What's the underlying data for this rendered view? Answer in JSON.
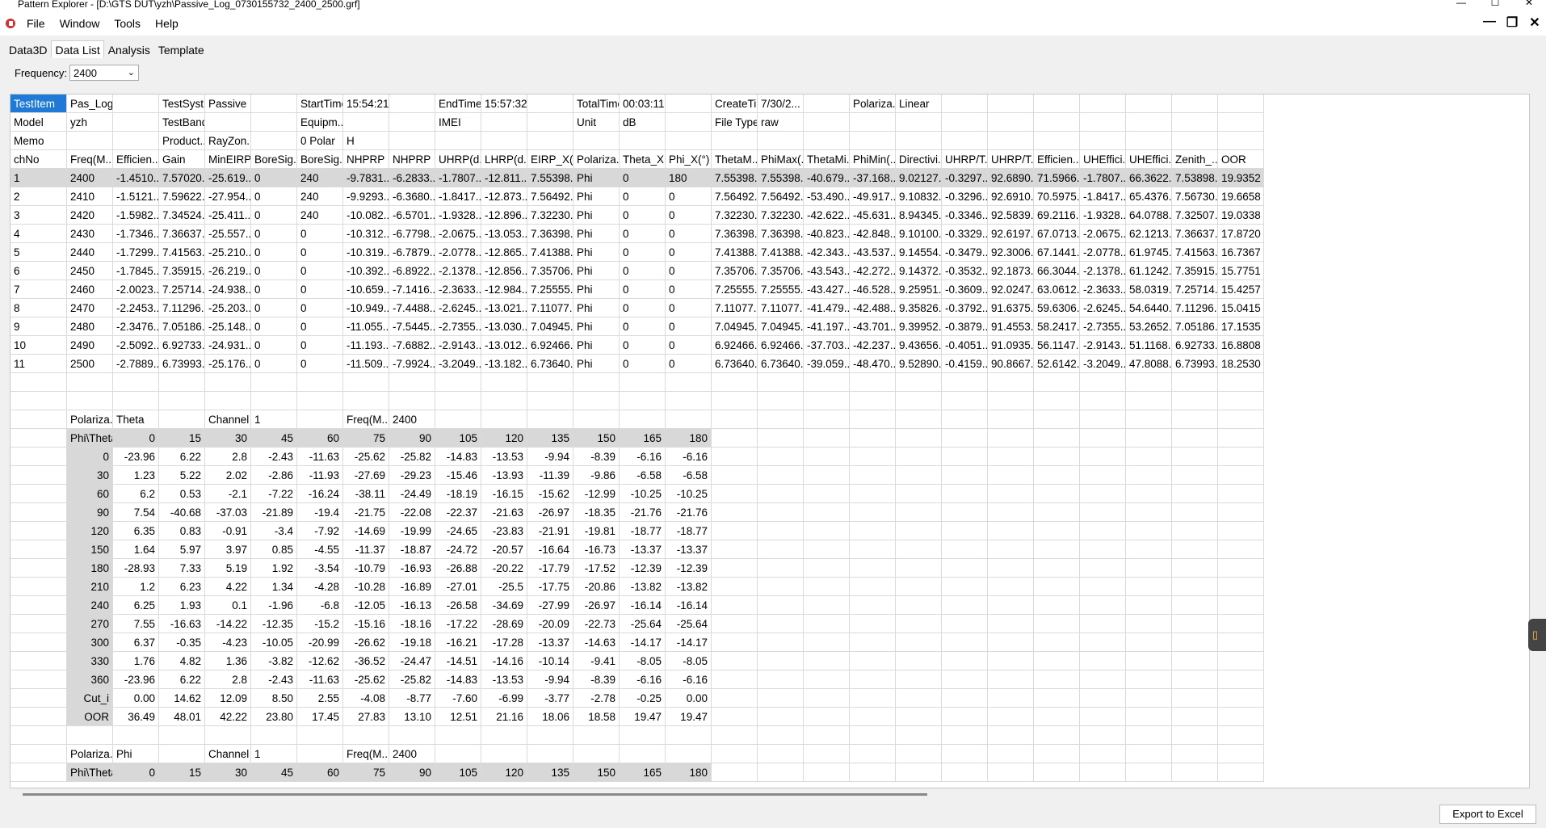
{
  "window": {
    "title": "Pattern Explorer - [D:\\GTS DUT\\yzh\\Passive_Log_0730155732_2400_2500.grf]"
  },
  "menu": [
    "File",
    "Window",
    "Tools",
    "Help"
  ],
  "tabs": [
    "Data3D",
    "Data List",
    "Analysis",
    "Template"
  ],
  "active_tab": "Data List",
  "frequency": {
    "label": "Frequency:",
    "value": "2400"
  },
  "export_label": "Export to Excel",
  "accent": "#1e7ad6",
  "rows": [
    [
      "TestItem",
      "Pas_Log",
      "",
      "TestSyst...",
      "Passive",
      "",
      "StartTime",
      "15:54:21",
      "",
      "EndTime",
      "15:57:32",
      "",
      "TotalTime",
      "00:03:11",
      "",
      "CreateTi...",
      "7/30/2...",
      "",
      "Polariza...",
      "Linear",
      "",
      "",
      "",
      "",
      "",
      "",
      ""
    ],
    [
      "Model",
      "yzh",
      "",
      "TestBand",
      "",
      "",
      "Equipm...",
      "",
      "",
      "IMEI",
      "",
      "",
      "Unit",
      "dB",
      "",
      "File Type",
      "raw",
      "",
      "",
      "",
      "",
      "",
      "",
      "",
      "",
      "",
      ""
    ],
    [
      "Memo",
      "",
      "",
      "Product...",
      "RayZon...",
      "",
      "0 Polar",
      "H",
      "",
      "",
      "",
      "",
      "",
      "",
      "",
      "",
      "",
      "",
      "",
      "",
      "",
      "",
      "",
      "",
      "",
      "",
      ""
    ],
    [
      "chNo",
      "Freq(M...",
      "Efficien...",
      "Gain",
      "MinEIRP...",
      "BoreSig...",
      "BoreSig...",
      "NHPRP ...",
      "NHPRP ...",
      "UHRP(d...",
      "LHRP(d...",
      "EIRP_X(...",
      "Polariza...",
      "Theta_X...",
      "Phi_X(°)",
      "ThetaM...",
      "PhiMax(...",
      "ThetaMi...",
      "PhiMin(...",
      "Directivi...",
      "UHRP/T...",
      "UHRP/T...",
      "Efficien...",
      "UHEffici...",
      "UHEffici...",
      "Zenith_...",
      "OOR"
    ],
    [
      "1",
      "2400",
      "-1.4510...",
      "7.57020...",
      "-25.619...",
      "0",
      "240",
      "-9.7831...",
      "-6.2833...",
      "-1.7807...",
      "-12.811...",
      "7.55398...",
      "Phi",
      "0",
      "180",
      "7.55398...",
      "7.55398...",
      "-40.679...",
      "-37.168...",
      "9.02127...",
      "-0.3297...",
      "92.6890...",
      "71.5966...",
      "-1.7807...",
      "66.3622...",
      "7.53898...",
      "19.9352"
    ],
    [
      "2",
      "2410",
      "-1.5121...",
      "7.59622...",
      "-27.954...",
      "0",
      "240",
      "-9.9293...",
      "-6.3680...",
      "-1.8417...",
      "-12.873...",
      "7.56492...",
      "Phi",
      "0",
      "0",
      "7.56492...",
      "7.56492...",
      "-53.490...",
      "-49.917...",
      "9.10832...",
      "-0.3296...",
      "92.6910...",
      "70.5975...",
      "-1.8417...",
      "65.4376...",
      "7.56730...",
      "19.6658"
    ],
    [
      "3",
      "2420",
      "-1.5982...",
      "7.34524...",
      "-25.411...",
      "0",
      "240",
      "-10.082...",
      "-6.5701...",
      "-1.9328...",
      "-12.896...",
      "7.32230...",
      "Phi",
      "0",
      "0",
      "7.32230...",
      "7.32230...",
      "-42.622...",
      "-45.631...",
      "8.94345...",
      "-0.3346...",
      "92.5839...",
      "69.2116...",
      "-1.9328...",
      "64.0788...",
      "7.32507...",
      "19.0338"
    ],
    [
      "4",
      "2430",
      "-1.7346...",
      "7.36637...",
      "-25.557...",
      "0",
      "0",
      "-10.312...",
      "-6.7798...",
      "-2.0675...",
      "-13.053...",
      "7.36398...",
      "Phi",
      "0",
      "0",
      "7.36398...",
      "7.36398...",
      "-40.823...",
      "-42.848...",
      "9.10100...",
      "-0.3329...",
      "92.6197...",
      "67.0713...",
      "-2.0675...",
      "62.1213...",
      "7.36637...",
      "17.8720"
    ],
    [
      "5",
      "2440",
      "-1.7299...",
      "7.41563...",
      "-25.210...",
      "0",
      "0",
      "-10.319...",
      "-6.7879...",
      "-2.0778...",
      "-12.865...",
      "7.41388...",
      "Phi",
      "0",
      "0",
      "7.41388...",
      "7.41388...",
      "-42.343...",
      "-43.537...",
      "9.14554...",
      "-0.3479...",
      "92.3006...",
      "67.1441...",
      "-2.0778...",
      "61.9745...",
      "7.41563...",
      "16.7367"
    ],
    [
      "6",
      "2450",
      "-1.7845...",
      "7.35915...",
      "-26.219...",
      "0",
      "0",
      "-10.392...",
      "-6.8922...",
      "-2.1378...",
      "-12.856...",
      "7.35706...",
      "Phi",
      "0",
      "0",
      "7.35706...",
      "7.35706...",
      "-43.543...",
      "-42.272...",
      "9.14372...",
      "-0.3532...",
      "92.1873...",
      "66.3044...",
      "-2.1378...",
      "61.1242...",
      "7.35915...",
      "15.7751"
    ],
    [
      "7",
      "2460",
      "-2.0023...",
      "7.25714...",
      "-24.938...",
      "0",
      "0",
      "-10.659...",
      "-7.1416...",
      "-2.3633...",
      "-12.984...",
      "7.25555...",
      "Phi",
      "0",
      "0",
      "7.25555...",
      "7.25555...",
      "-43.427...",
      "-46.528...",
      "9.25951...",
      "-0.3609...",
      "92.0247...",
      "63.0612...",
      "-2.3633...",
      "58.0319...",
      "7.25714...",
      "15.4257"
    ],
    [
      "8",
      "2470",
      "-2.2453...",
      "7.11296...",
      "-25.203...",
      "0",
      "0",
      "-10.949...",
      "-7.4488...",
      "-2.6245...",
      "-13.021...",
      "7.11077...",
      "Phi",
      "0",
      "0",
      "7.11077...",
      "7.11077...",
      "-41.479...",
      "-42.488...",
      "9.35826...",
      "-0.3792...",
      "91.6375...",
      "59.6306...",
      "-2.6245...",
      "54.6440...",
      "7.11296...",
      "15.0415"
    ],
    [
      "9",
      "2480",
      "-2.3476...",
      "7.05186...",
      "-25.148...",
      "0",
      "0",
      "-11.055...",
      "-7.5445...",
      "-2.7355...",
      "-13.030...",
      "7.04945...",
      "Phi",
      "0",
      "0",
      "7.04945...",
      "7.04945...",
      "-41.197...",
      "-43.701...",
      "9.39952...",
      "-0.3879...",
      "91.4553...",
      "58.2417...",
      "-2.7355...",
      "53.2652...",
      "7.05186...",
      "17.1535"
    ],
    [
      "10",
      "2490",
      "-2.5092...",
      "6.92733...",
      "-24.931...",
      "0",
      "0",
      "-11.193...",
      "-7.6882...",
      "-2.9143...",
      "-13.012...",
      "6.92466...",
      "Phi",
      "0",
      "0",
      "6.92466...",
      "6.92466...",
      "-37.703...",
      "-42.237...",
      "9.43656...",
      "-0.4051...",
      "91.0935...",
      "56.1147...",
      "-2.9143...",
      "51.1168...",
      "6.92733...",
      "16.8808"
    ],
    [
      "11",
      "2500",
      "-2.7889...",
      "6.73993...",
      "-25.176...",
      "0",
      "0",
      "-11.509...",
      "-7.9924...",
      "-3.2049...",
      "-13.182...",
      "6.73640...",
      "Phi",
      "0",
      "0",
      "6.73640...",
      "6.73640...",
      "-39.059...",
      "-48.470...",
      "9.52890...",
      "-0.4159...",
      "90.8667...",
      "52.6142...",
      "-3.2049...",
      "47.8088...",
      "6.73993...",
      "18.2530"
    ],
    [
      "",
      "",
      "",
      "",
      "",
      "",
      "",
      "",
      "",
      "",
      "",
      "",
      "",
      "",
      "",
      "",
      "",
      "",
      "",
      "",
      "",
      "",
      "",
      "",
      "",
      "",
      ""
    ],
    [
      "",
      "",
      "",
      "",
      "",
      "",
      "",
      "",
      "",
      "",
      "",
      "",
      "",
      "",
      "",
      "",
      "",
      "",
      "",
      "",
      "",
      "",
      "",
      "",
      "",
      "",
      ""
    ],
    [
      "",
      "Polariza...",
      "Theta",
      "",
      "Channel",
      "1",
      "",
      "Freq(M...",
      "2400",
      "",
      "",
      "",
      "",
      "",
      "",
      "",
      "",
      "",
      "",
      "",
      "",
      "",
      "",
      "",
      "",
      "",
      ""
    ],
    [
      "",
      "Phi\\Theta",
      "0",
      "15",
      "30",
      "45",
      "60",
      "75",
      "90",
      "105",
      "120",
      "135",
      "150",
      "165",
      "180",
      "",
      "",
      "",
      "",
      "",
      "",
      "",
      "",
      "",
      "",
      "",
      ""
    ],
    [
      "",
      "0",
      "-23.96",
      "6.22",
      "2.8",
      "-2.43",
      "-11.63",
      "-25.62",
      "-25.82",
      "-14.83",
      "-13.53",
      "-9.94",
      "-8.39",
      "-6.16",
      "-6.16",
      "",
      "",
      "",
      "",
      "",
      "",
      "",
      "",
      "",
      "",
      "",
      ""
    ],
    [
      "",
      "30",
      "1.23",
      "5.22",
      "2.02",
      "-2.86",
      "-11.93",
      "-27.69",
      "-29.23",
      "-15.46",
      "-13.93",
      "-11.39",
      "-9.86",
      "-6.58",
      "-6.58",
      "",
      "",
      "",
      "",
      "",
      "",
      "",
      "",
      "",
      "",
      "",
      ""
    ],
    [
      "",
      "60",
      "6.2",
      "0.53",
      "-2.1",
      "-7.22",
      "-16.24",
      "-38.11",
      "-24.49",
      "-18.19",
      "-16.15",
      "-15.62",
      "-12.99",
      "-10.25",
      "-10.25",
      "",
      "",
      "",
      "",
      "",
      "",
      "",
      "",
      "",
      "",
      "",
      ""
    ],
    [
      "",
      "90",
      "7.54",
      "-40.68",
      "-37.03",
      "-21.89",
      "-19.4",
      "-21.75",
      "-22.08",
      "-22.37",
      "-21.63",
      "-26.97",
      "-18.35",
      "-21.76",
      "-21.76",
      "",
      "",
      "",
      "",
      "",
      "",
      "",
      "",
      "",
      "",
      "",
      ""
    ],
    [
      "",
      "120",
      "6.35",
      "0.83",
      "-0.91",
      "-3.4",
      "-7.92",
      "-14.69",
      "-19.99",
      "-24.65",
      "-23.83",
      "-21.91",
      "-19.81",
      "-18.77",
      "-18.77",
      "",
      "",
      "",
      "",
      "",
      "",
      "",
      "",
      "",
      "",
      "",
      ""
    ],
    [
      "",
      "150",
      "1.64",
      "5.97",
      "3.97",
      "0.85",
      "-4.55",
      "-11.37",
      "-18.87",
      "-24.72",
      "-20.57",
      "-16.64",
      "-16.73",
      "-13.37",
      "-13.37",
      "",
      "",
      "",
      "",
      "",
      "",
      "",
      "",
      "",
      "",
      "",
      ""
    ],
    [
      "",
      "180",
      "-28.93",
      "7.33",
      "5.19",
      "1.92",
      "-3.54",
      "-10.79",
      "-16.93",
      "-26.88",
      "-20.22",
      "-17.79",
      "-17.52",
      "-12.39",
      "-12.39",
      "",
      "",
      "",
      "",
      "",
      "",
      "",
      "",
      "",
      "",
      "",
      ""
    ],
    [
      "",
      "210",
      "1.2",
      "6.23",
      "4.22",
      "1.34",
      "-4.28",
      "-10.28",
      "-16.89",
      "-27.01",
      "-25.5",
      "-17.75",
      "-20.86",
      "-13.82",
      "-13.82",
      "",
      "",
      "",
      "",
      "",
      "",
      "",
      "",
      "",
      "",
      "",
      ""
    ],
    [
      "",
      "240",
      "6.25",
      "1.93",
      "0.1",
      "-1.96",
      "-6.8",
      "-12.05",
      "-16.13",
      "-26.58",
      "-34.69",
      "-27.99",
      "-26.97",
      "-16.14",
      "-16.14",
      "",
      "",
      "",
      "",
      "",
      "",
      "",
      "",
      "",
      "",
      "",
      ""
    ],
    [
      "",
      "270",
      "7.55",
      "-16.63",
      "-14.22",
      "-12.35",
      "-15.2",
      "-15.16",
      "-18.16",
      "-17.22",
      "-28.69",
      "-20.09",
      "-22.73",
      "-25.64",
      "-25.64",
      "",
      "",
      "",
      "",
      "",
      "",
      "",
      "",
      "",
      "",
      "",
      ""
    ],
    [
      "",
      "300",
      "6.37",
      "-0.35",
      "-4.23",
      "-10.05",
      "-20.99",
      "-26.62",
      "-19.18",
      "-16.21",
      "-17.28",
      "-13.37",
      "-14.63",
      "-14.17",
      "-14.17",
      "",
      "",
      "",
      "",
      "",
      "",
      "",
      "",
      "",
      "",
      "",
      ""
    ],
    [
      "",
      "330",
      "1.76",
      "4.82",
      "1.36",
      "-3.82",
      "-12.62",
      "-36.52",
      "-24.47",
      "-14.51",
      "-14.16",
      "-10.14",
      "-9.41",
      "-8.05",
      "-8.05",
      "",
      "",
      "",
      "",
      "",
      "",
      "",
      "",
      "",
      "",
      "",
      ""
    ],
    [
      "",
      "360",
      "-23.96",
      "6.22",
      "2.8",
      "-2.43",
      "-11.63",
      "-25.62",
      "-25.82",
      "-14.83",
      "-13.53",
      "-9.94",
      "-8.39",
      "-6.16",
      "-6.16",
      "",
      "",
      "",
      "",
      "",
      "",
      "",
      "",
      "",
      "",
      "",
      ""
    ],
    [
      "",
      "Cut_i",
      "0.00",
      "14.62",
      "12.09",
      "8.50",
      "2.55",
      "-4.08",
      "-8.77",
      "-7.60",
      "-6.99",
      "-3.77",
      "-2.78",
      "-0.25",
      "0.00",
      "",
      "",
      "",
      "",
      "",
      "",
      "",
      "",
      "",
      "",
      "",
      ""
    ],
    [
      "",
      "OOR",
      "36.49",
      "48.01",
      "42.22",
      "23.80",
      "17.45",
      "27.83",
      "13.10",
      "12.51",
      "21.16",
      "18.06",
      "18.58",
      "19.47",
      "19.47",
      "",
      "",
      "",
      "",
      "",
      "",
      "",
      "",
      "",
      "",
      "",
      ""
    ],
    [
      "",
      "",
      "",
      "",
      "",
      "",
      "",
      "",
      "",
      "",
      "",
      "",
      "",
      "",
      "",
      "",
      "",
      "",
      "",
      "",
      "",
      "",
      "",
      "",
      "",
      "",
      ""
    ],
    [
      "",
      "Polariza...",
      "Phi",
      "",
      "Channel",
      "1",
      "",
      "Freq(M...",
      "2400",
      "",
      "",
      "",
      "",
      "",
      "",
      "",
      "",
      "",
      "",
      "",
      "",
      "",
      "",
      "",
      "",
      "",
      ""
    ],
    [
      "",
      "Phi\\Theta",
      "0",
      "15",
      "30",
      "45",
      "60",
      "75",
      "90",
      "105",
      "120",
      "135",
      "150",
      "165",
      "180",
      "",
      "",
      "",
      "",
      "",
      "",
      "",
      "",
      "",
      "",
      "",
      ""
    ]
  ]
}
